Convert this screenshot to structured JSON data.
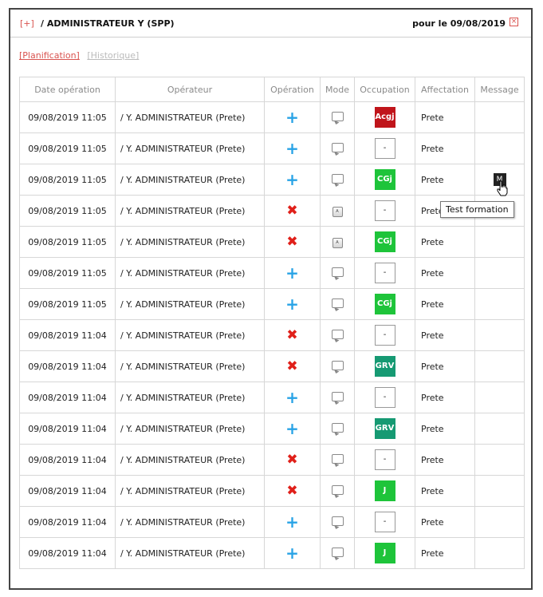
{
  "header": {
    "expand_label": "[+]",
    "title": "/ ADMINISTRATEUR Y (SPP)",
    "date_label": "pour le 09/08/2019",
    "close_icon": "close-icon"
  },
  "links": {
    "planification": "[Planification]",
    "historique": "[Historique]"
  },
  "table": {
    "headers": [
      "Date opération",
      "Opérateur",
      "Opération",
      "Mode",
      "Occupation",
      "Affectation",
      "Message"
    ],
    "rows": [
      {
        "date": "09/08/2019 11:05",
        "operator": "/ Y. ADMINISTRATEUR (Prete)",
        "op": "+",
        "mode": "bubble",
        "occ": "Acgj",
        "occ_color": "#c0151b",
        "aff": "Prete",
        "msg": ""
      },
      {
        "date": "09/08/2019 11:05",
        "operator": "/ Y. ADMINISTRATEUR (Prete)",
        "op": "+",
        "mode": "bubble",
        "occ": "-",
        "occ_color": "",
        "aff": "Prete",
        "msg": ""
      },
      {
        "date": "09/08/2019 11:05",
        "operator": "/ Y. ADMINISTRATEUR (Prete)",
        "op": "+",
        "mode": "bubble",
        "occ": "CGj",
        "occ_color": "#1ec43a",
        "aff": "Prete",
        "msg": "M"
      },
      {
        "date": "09/08/2019 11:05",
        "operator": "/ Y. ADMINISTRATEUR (Prete)",
        "op": "x",
        "mode": "key",
        "occ": "-",
        "occ_color": "",
        "aff": "Prete",
        "msg": ""
      },
      {
        "date": "09/08/2019 11:05",
        "operator": "/ Y. ADMINISTRATEUR (Prete)",
        "op": "x",
        "mode": "key",
        "occ": "CGj",
        "occ_color": "#1ec43a",
        "aff": "Prete",
        "msg": ""
      },
      {
        "date": "09/08/2019 11:05",
        "operator": "/ Y. ADMINISTRATEUR (Prete)",
        "op": "+",
        "mode": "bubble",
        "occ": "-",
        "occ_color": "",
        "aff": "Prete",
        "msg": ""
      },
      {
        "date": "09/08/2019 11:05",
        "operator": "/ Y. ADMINISTRATEUR (Prete)",
        "op": "+",
        "mode": "bubble",
        "occ": "CGj",
        "occ_color": "#1ec43a",
        "aff": "Prete",
        "msg": ""
      },
      {
        "date": "09/08/2019 11:04",
        "operator": "/ Y. ADMINISTRATEUR (Prete)",
        "op": "x",
        "mode": "bubble",
        "occ": "-",
        "occ_color": "",
        "aff": "Prete",
        "msg": ""
      },
      {
        "date": "09/08/2019 11:04",
        "operator": "/ Y. ADMINISTRATEUR (Prete)",
        "op": "x",
        "mode": "bubble",
        "occ": "GRV",
        "occ_color": "#169a73",
        "aff": "Prete",
        "msg": ""
      },
      {
        "date": "09/08/2019 11:04",
        "operator": "/ Y. ADMINISTRATEUR (Prete)",
        "op": "+",
        "mode": "bubble",
        "occ": "-",
        "occ_color": "",
        "aff": "Prete",
        "msg": ""
      },
      {
        "date": "09/08/2019 11:04",
        "operator": "/ Y. ADMINISTRATEUR (Prete)",
        "op": "+",
        "mode": "bubble",
        "occ": "GRV",
        "occ_color": "#169a73",
        "aff": "Prete",
        "msg": ""
      },
      {
        "date": "09/08/2019 11:04",
        "operator": "/ Y. ADMINISTRATEUR (Prete)",
        "op": "x",
        "mode": "bubble",
        "occ": "-",
        "occ_color": "",
        "aff": "Prete",
        "msg": ""
      },
      {
        "date": "09/08/2019 11:04",
        "operator": "/ Y. ADMINISTRATEUR (Prete)",
        "op": "x",
        "mode": "bubble",
        "occ": "J",
        "occ_color": "#1ec43a",
        "aff": "Prete",
        "msg": ""
      },
      {
        "date": "09/08/2019 11:04",
        "operator": "/ Y. ADMINISTRATEUR (Prete)",
        "op": "+",
        "mode": "bubble",
        "occ": "-",
        "occ_color": "",
        "aff": "Prete",
        "msg": ""
      },
      {
        "date": "09/08/2019 11:04",
        "operator": "/ Y. ADMINISTRATEUR (Prete)",
        "op": "+",
        "mode": "bubble",
        "occ": "J",
        "occ_color": "#1ec43a",
        "aff": "Prete",
        "msg": ""
      }
    ]
  },
  "tooltip": {
    "text": "Test formation"
  },
  "colors": {
    "accent_red": "#d9534f",
    "plus_blue": "#29a3e6",
    "cross_red": "#e0201a"
  }
}
